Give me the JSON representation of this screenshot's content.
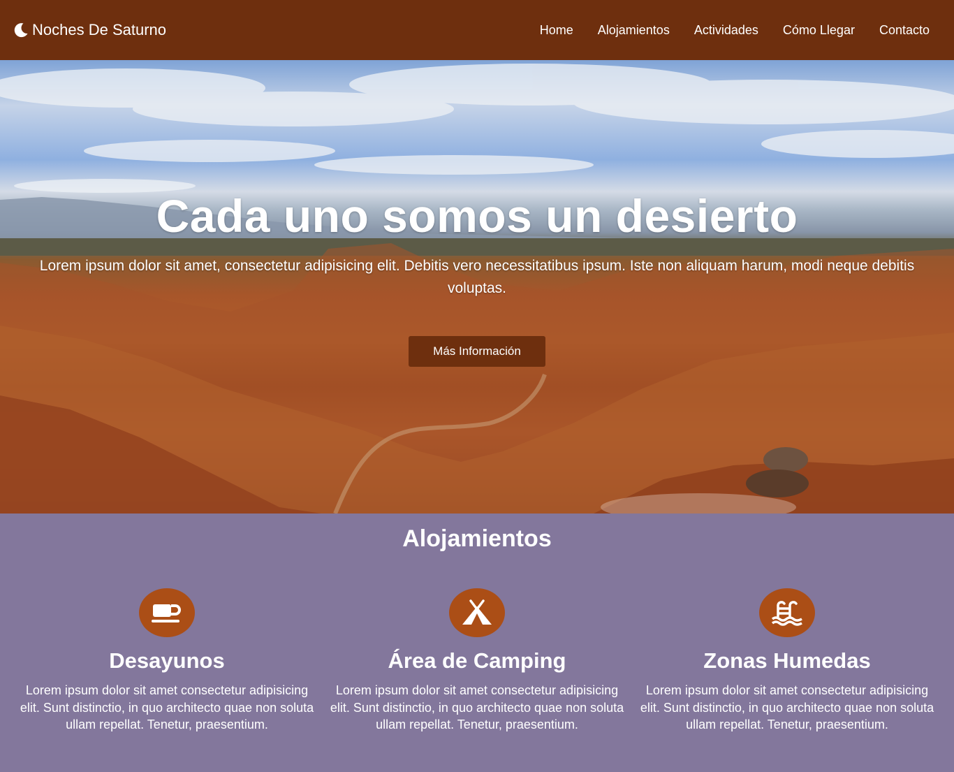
{
  "navbar": {
    "brand": "Noches De Saturno",
    "brand_icon": "moon-icon",
    "links": [
      "Home",
      "Alojamientos",
      "Actividades",
      "Cómo Llegar",
      "Contacto"
    ]
  },
  "hero": {
    "title": "Cada uno somos un desierto",
    "text": "Lorem ipsum dolor sit amet, consectetur adipisicing elit. Debitis vero necessitatibus ipsum. Iste non aliquam harum, modi neque debitis voluptas.",
    "button": "Más Información"
  },
  "alojamientos": {
    "title": "Alojamientos",
    "features": [
      {
        "icon": "coffee-icon",
        "title": "Desayunos",
        "text": "Lorem ipsum dolor sit amet consectetur adipisicing elit. Sunt distinctio, in quo architecto quae non soluta ullam repellat. Tenetur, praesentium."
      },
      {
        "icon": "tent-icon",
        "title": "Área de Camping",
        "text": "Lorem ipsum dolor sit amet consectetur adipisicing elit. Sunt distinctio, in quo architecto quae non soluta ullam repellat. Tenetur, praesentium."
      },
      {
        "icon": "swimming-pool-icon",
        "title": "Zonas Humedas",
        "text": "Lorem ipsum dolor sit amet consectetur adipisicing elit. Sunt distinctio, in quo architecto quae non soluta ullam repellat. Tenetur, praesentium."
      }
    ]
  },
  "colors": {
    "navbar": "#6e2f0e",
    "section_bg": "#83779c",
    "icon_circle": "#ab4e16",
    "button": "#6e2f0e"
  }
}
